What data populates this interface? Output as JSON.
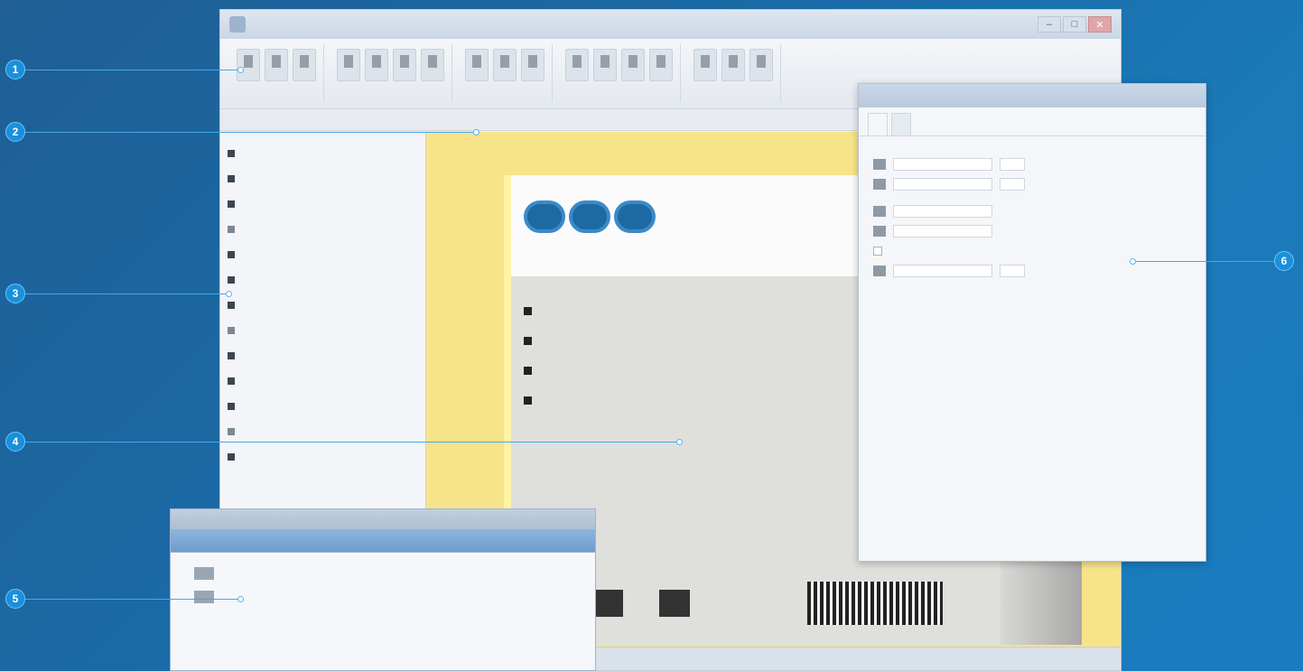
{
  "main_window": {
    "title": "",
    "ribbon_groups": [
      {
        "label": "",
        "buttons": 3
      },
      {
        "label": "",
        "buttons": 4
      },
      {
        "label": "",
        "buttons": 3
      },
      {
        "label": "",
        "buttons": 4
      },
      {
        "label": "",
        "buttons": 3
      }
    ],
    "subbar_items": [
      "",
      "",
      "",
      ""
    ],
    "tree_items": [
      "",
      "",
      "",
      "",
      "",
      "",
      "",
      "",
      "",
      "",
      "",
      "",
      ""
    ],
    "page": {
      "heading_line1": "",
      "heading_line2": "",
      "list_items": [
        "",
        "",
        "",
        ""
      ]
    },
    "status_text": ""
  },
  "dialog": {
    "title": "",
    "tabs": [
      "",
      ""
    ],
    "sections": [
      "",
      "",
      ""
    ],
    "links": [
      "",
      "",
      ""
    ]
  },
  "mini_window": {
    "title": "",
    "tabs": [
      "",
      "",
      ""
    ],
    "rows": [
      "",
      ""
    ]
  },
  "callouts": {
    "c1": "1",
    "c2": "2",
    "c3": "3",
    "c4": "4",
    "c5": "5",
    "c6": "6"
  },
  "colors": {
    "background_dark": "#1f5f95",
    "background_light": "#1a7cc0",
    "callout_badge": "#1990dc",
    "canvas_yellow": "#f7e48a",
    "accent_blue": "#1d6aa3"
  }
}
